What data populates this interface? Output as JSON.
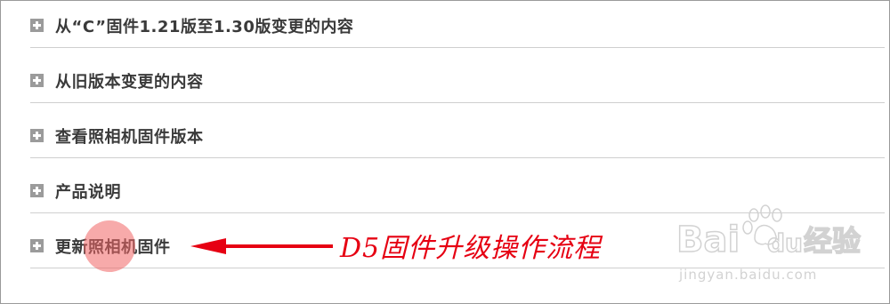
{
  "accordion": {
    "items": [
      {
        "label": "从“C”固件1.21版至1.30版变更的内容"
      },
      {
        "label": "从旧版本变更的内容"
      },
      {
        "label": "查看照相机固件版本"
      },
      {
        "label": "产品说明"
      },
      {
        "label": "更新照相机固件"
      }
    ]
  },
  "annotation": {
    "text": "D5固件升级操作流程",
    "color": "#e60012"
  },
  "watermark": {
    "brand_text": "Bai",
    "brand_text_2": "du",
    "product_text": "经验",
    "url_text": "jingyan.baidu.com"
  },
  "colors": {
    "icon_bg": "#9b9b9b",
    "label_text": "#3a3a3a",
    "divider": "#cfcfcf",
    "highlight": "#f06464"
  }
}
